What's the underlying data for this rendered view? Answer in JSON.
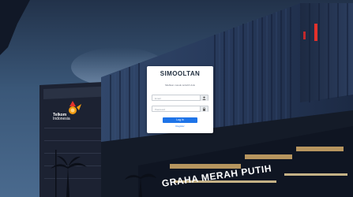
{
  "login": {
    "title": "SIMOOLTAN",
    "subtitle": "Silahkan masuk terlebih dulu",
    "username": {
      "value": "",
      "placeholder": "Email",
      "icon": "user-icon"
    },
    "password": {
      "value": "",
      "placeholder": "Password",
      "icon": "lock-icon"
    },
    "login_label": "Log in",
    "register_label": "Register"
  },
  "background": {
    "building_sign": "GRAHA MERAH PUTIH",
    "logo_line1": "Telkom",
    "logo_line2": "Indonesia"
  },
  "colors": {
    "accent": "#1e74e8",
    "sky": "#2b3f5c",
    "sign_text": "#ffffff",
    "logo_red": "#e4312b"
  }
}
